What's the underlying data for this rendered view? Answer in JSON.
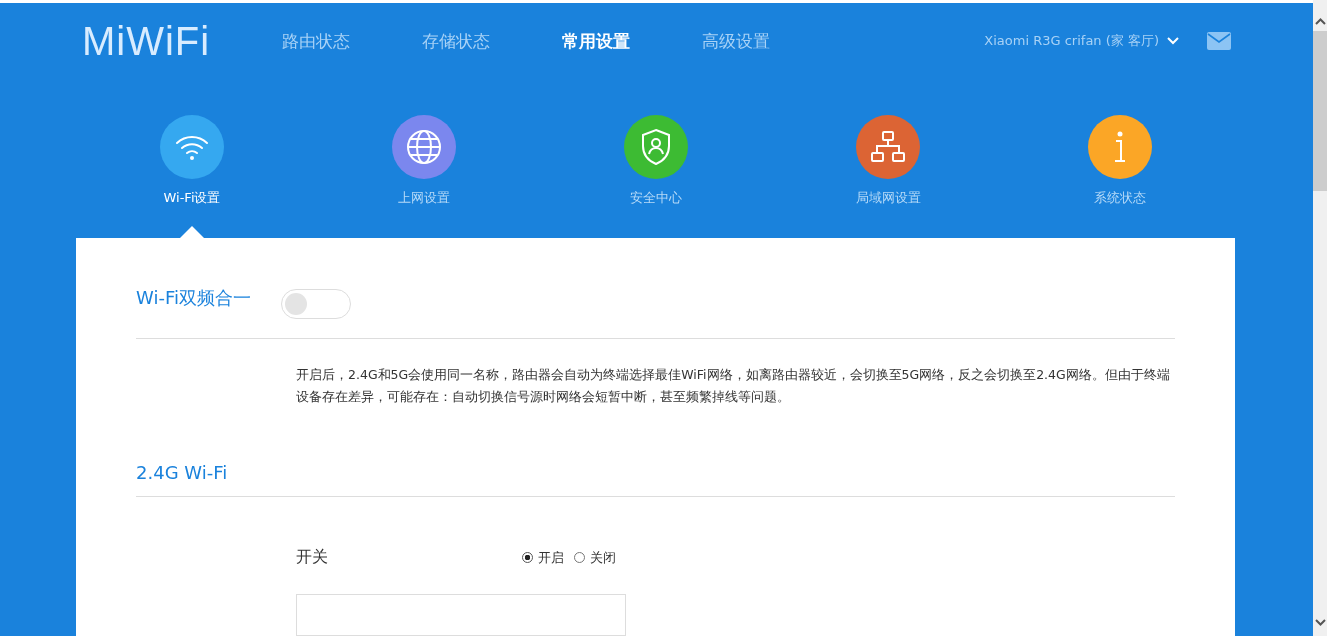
{
  "logo": "MiWiFi",
  "nav": [
    {
      "label": "路由状态",
      "selected": false
    },
    {
      "label": "存储状态",
      "selected": false
    },
    {
      "label": "常用设置",
      "selected": true
    },
    {
      "label": "高级设置",
      "selected": false
    }
  ],
  "device": "Xiaomi R3G crifan (家 客厅)",
  "features": [
    {
      "kind": "wifi",
      "label": "Wi-Fi设置",
      "color": "#35a8f0",
      "selected": true
    },
    {
      "kind": "globe",
      "label": "上网设置",
      "color": "#7b87ee",
      "selected": false
    },
    {
      "kind": "shield",
      "label": "安全中心",
      "color": "#3dbb33",
      "selected": false
    },
    {
      "kind": "lan",
      "label": "局域网设置",
      "color": "#dc6434",
      "selected": false
    },
    {
      "kind": "info",
      "label": "系统状态",
      "color": "#fba626",
      "selected": false
    }
  ],
  "dual_band": {
    "title": "Wi-Fi双频合一",
    "on": false,
    "description": "开启后，2.4G和5G会使用同一名称，路由器会自动为终端选择最佳WiFi网络，如离路由器较近，会切换至5G网络，反之会切换至2.4G网络。但由于终端设备存在差异，可能存在：自动切换信号源时网络会短暂中断，甚至频繁掉线等问题。"
  },
  "wifi_24": {
    "title": "2.4G Wi-Fi",
    "switch_label": "开关",
    "options": [
      {
        "label": "开启",
        "selected": true
      },
      {
        "label": "关闭",
        "selected": false
      }
    ]
  }
}
